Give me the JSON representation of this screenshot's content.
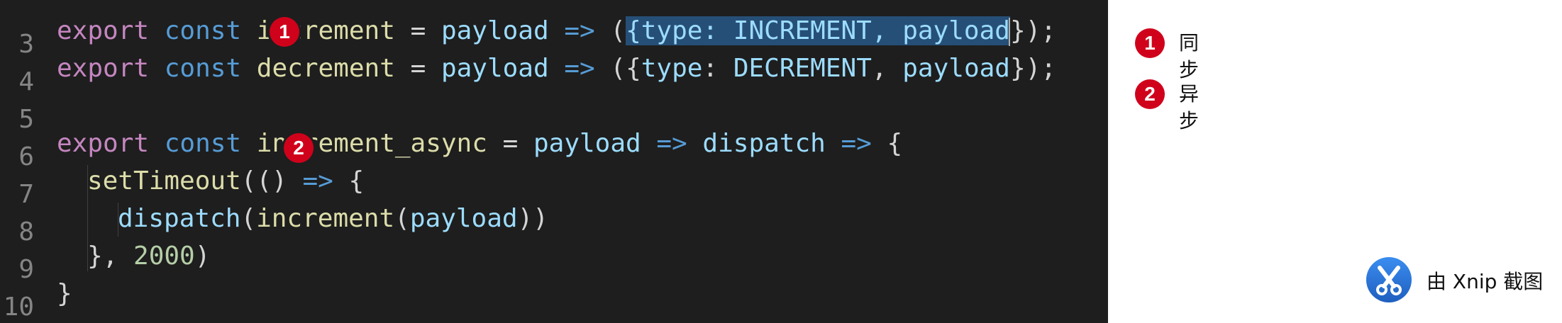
{
  "editor": {
    "lines": [
      {
        "number": "3"
      },
      {
        "number": "4"
      },
      {
        "number": "5"
      },
      {
        "number": "6"
      },
      {
        "number": "7"
      },
      {
        "number": "8"
      },
      {
        "number": "9"
      },
      {
        "number": "10"
      }
    ],
    "tokens": {
      "l3_export": "export",
      "l3_const": "const",
      "l3_name": "increment",
      "l3_eq": "=",
      "l3_param": "payload",
      "l3_arrow": "=>",
      "l3_open": "(",
      "l3_sel_obj": "{type: INCREMENT, payload",
      "l3_close": "});",
      "l4_export": "export",
      "l4_const": "const",
      "l4_name": "decrement",
      "l4_eq": "=",
      "l4_param": "payload",
      "l4_arrow": "=>",
      "l4_open": "({",
      "l4_type": "type",
      "l4_colon": ": ",
      "l4_const_name": "DECREMENT",
      "l4_comma": ", ",
      "l4_payload": "payload",
      "l4_close": "});",
      "l6_export": "export",
      "l6_const": "const",
      "l6_name": "increment_async",
      "l6_eq": "=",
      "l6_param": "payload",
      "l6_arrow1": "=>",
      "l6_dispatch": "dispatch",
      "l6_arrow2": "=>",
      "l6_brace": "{",
      "l7_fn": "setTimeout",
      "l7_open": "(() ",
      "l7_arrow": "=>",
      "l7_brace": " {",
      "l8_fn": "dispatch",
      "l8_open": "(",
      "l8_inc": "increment",
      "l8_open2": "(",
      "l8_payload": "payload",
      "l8_close": "))",
      "l9_close": "}, ",
      "l9_num": "2000",
      "l9_paren": ")",
      "l10_brace": "}"
    }
  },
  "markers": [
    {
      "label": "1"
    },
    {
      "label": "2"
    }
  ],
  "legend": [
    {
      "marker": "1",
      "text": "同步"
    },
    {
      "marker": "2",
      "text": "异步"
    }
  ],
  "watermark": {
    "text": "由 Xnip 截图",
    "icon": "xnip-scissors-icon"
  },
  "colors": {
    "editor_bg": "#1e1e1e",
    "marker": "#d0021b",
    "selection": "#264f78"
  }
}
